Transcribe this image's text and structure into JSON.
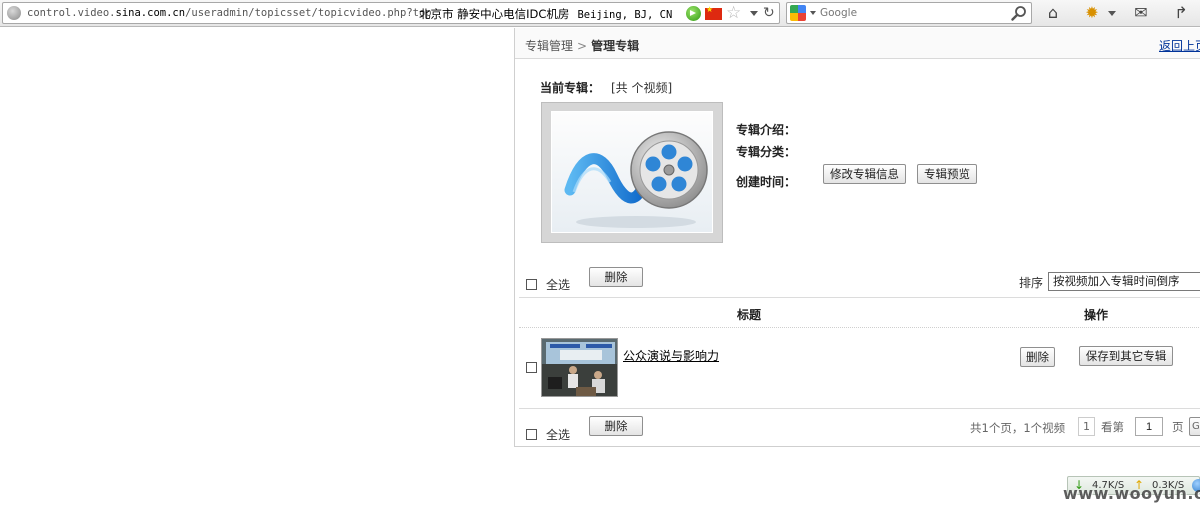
{
  "browser": {
    "url_prefix": "control.video.",
    "url_domain": "sina.com.cn",
    "url_path": "/useradmin/topicsset/topicvideo.php?top",
    "geo_city": "北京市 静安中心电信IDC机房",
    "geo_loc": "Beijing, BJ, CN",
    "search_placeholder": "Google"
  },
  "icons": {
    "home": "⌂",
    "addon": "✹",
    "mail": "✉",
    "share": "↱",
    "star": "☆",
    "reload": "↻"
  },
  "breadcrumb": {
    "parent": "专辑管理",
    "separator": ">",
    "current": "管理专辑",
    "back": "返回上页"
  },
  "album": {
    "current_label": "当前专辑：",
    "count_text": "[共 个视频]",
    "intro_label": "专辑介绍：",
    "category_label": "专辑分类：",
    "created_label": "创建时间：",
    "edit_button": "修改专辑信息",
    "preview_button": "专辑预览"
  },
  "list": {
    "select_all": "全选",
    "delete_button": "删除",
    "sort_label": "排序",
    "sort_selected": "按视频加入专辑时间倒序",
    "col_title": "标题",
    "col_ops": "操作",
    "rows": [
      {
        "title": "公众演说与影响力",
        "delete_label": "删除",
        "save_label": "保存到其它专辑"
      }
    ]
  },
  "pagination": {
    "info": "共1个页，1个视频",
    "current_page": "1",
    "goto_label": "看第",
    "goto_value": "1",
    "suffix": "页",
    "go_label": "GO"
  },
  "netspeed": {
    "down": "4.7K/S",
    "up": "0.3K/S"
  },
  "watermark": "www.wooyun.org",
  "colors": {
    "link": "#003399",
    "border": "#cfcfcf"
  }
}
